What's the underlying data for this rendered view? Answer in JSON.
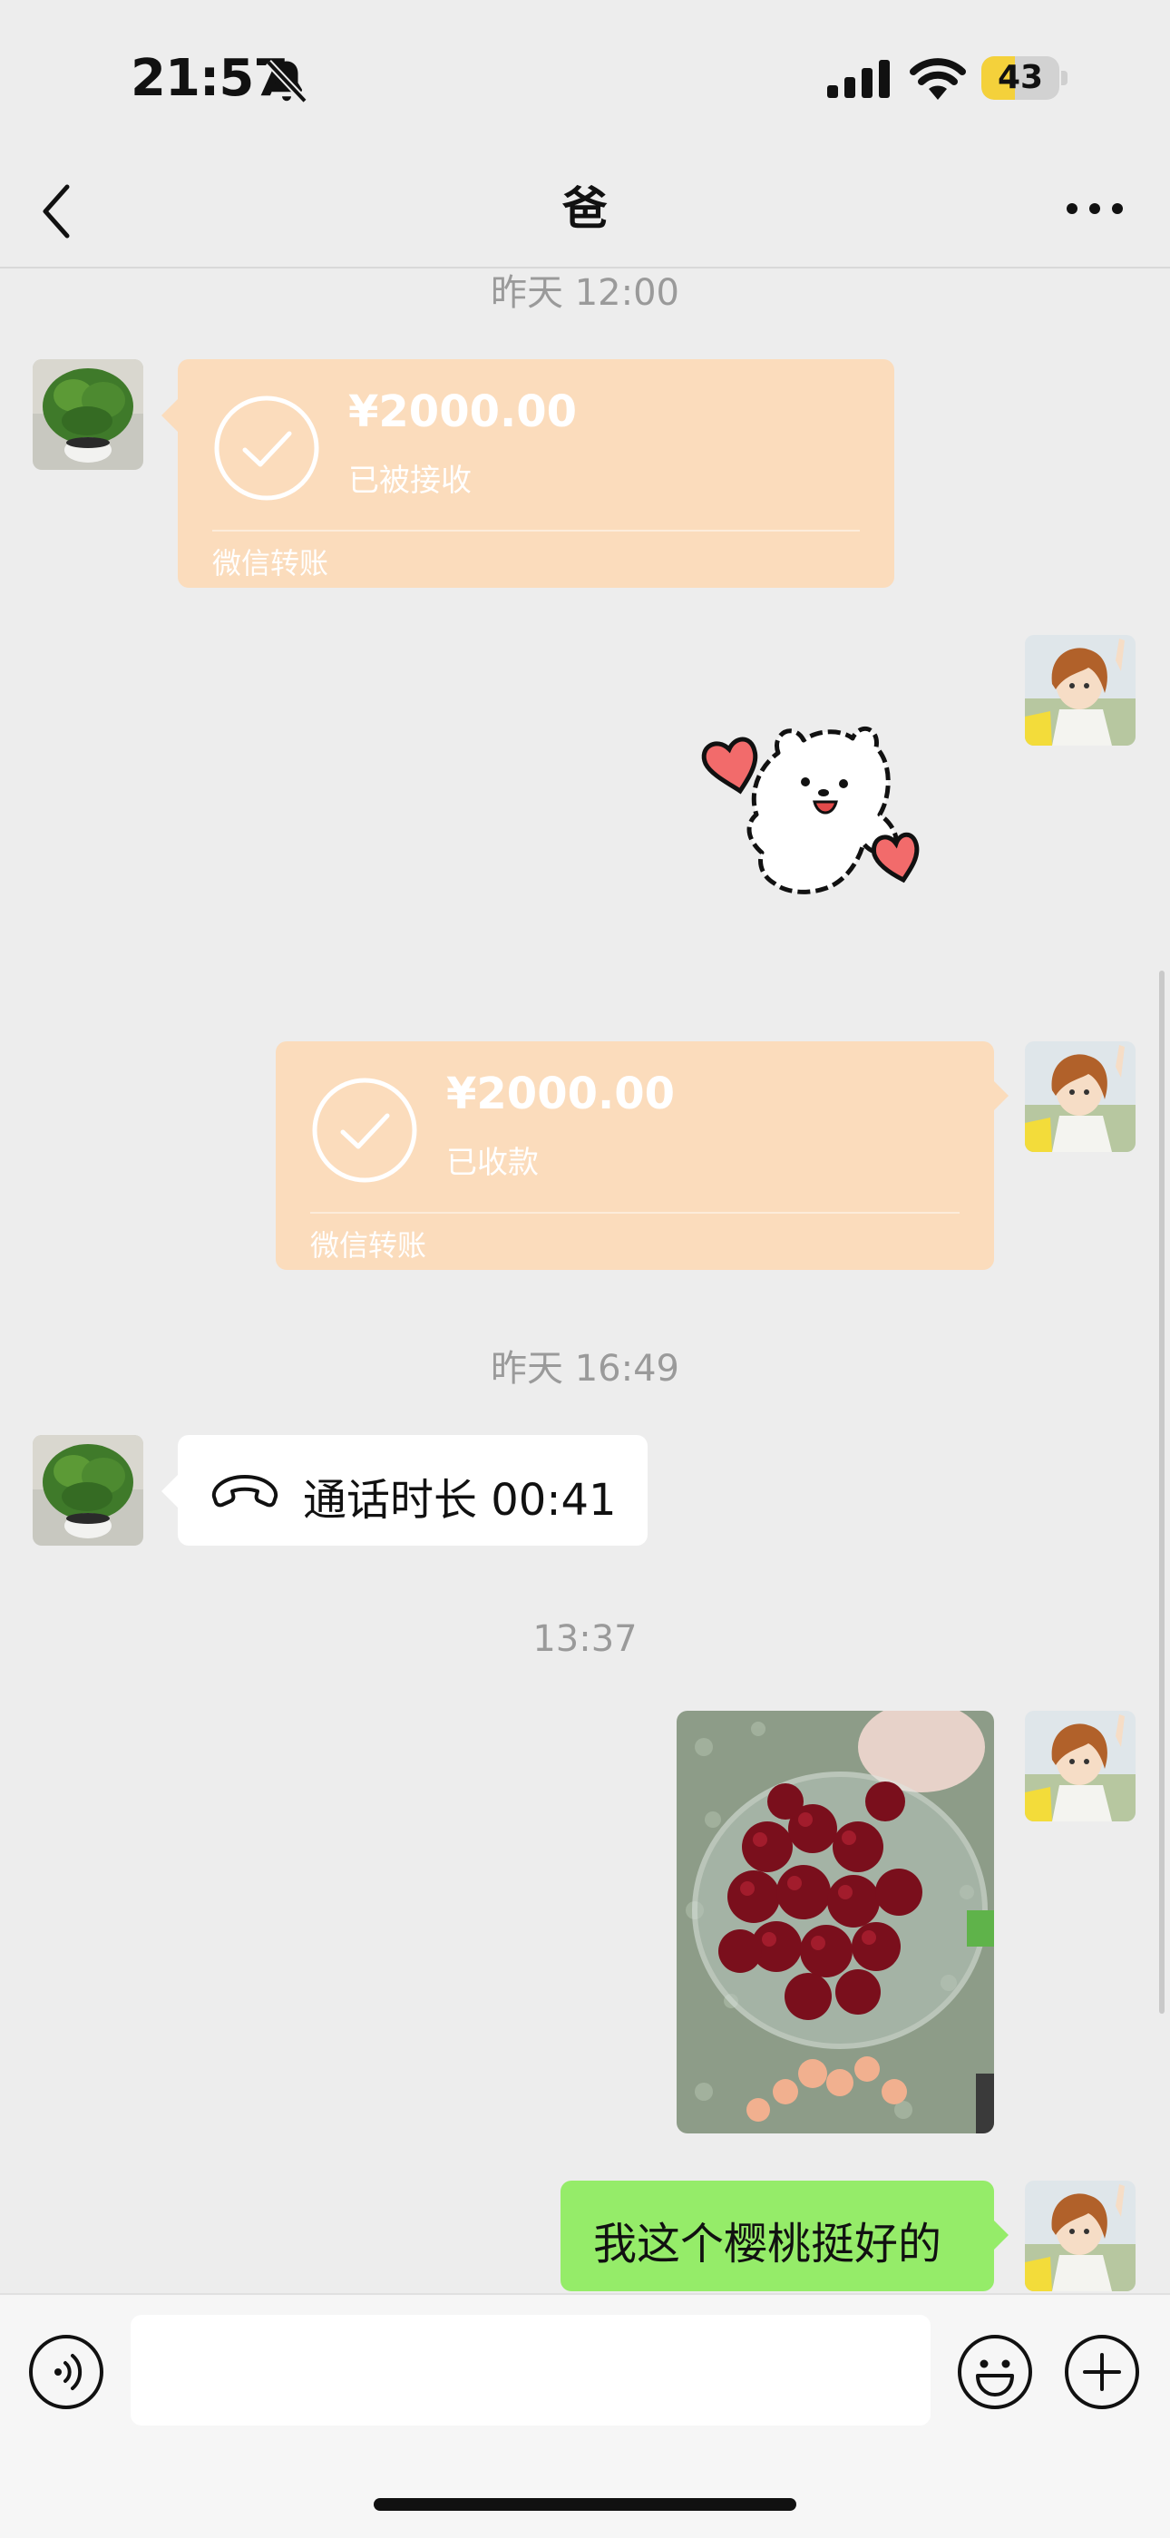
{
  "status_bar": {
    "time": "21:57",
    "battery_level": "43",
    "battery_fraction": 0.43,
    "battery_color": "#f4d13b",
    "icons": [
      "bell-slash-icon",
      "cellular-signal-icon",
      "wifi-icon",
      "battery-icon"
    ]
  },
  "nav": {
    "title": "爸",
    "back_icon": "chevron-left-icon",
    "more_icon": "ellipsis-icon"
  },
  "messages": {
    "timestamp_1": "昨天 12:00",
    "transfer_1": {
      "amount": "¥2000.00",
      "status": "已被接收",
      "source": "微信转账",
      "sender": "contact"
    },
    "sticker": {
      "icon": "bear-with-hearts-sticker",
      "sender": "me"
    },
    "transfer_2": {
      "amount": "¥2000.00",
      "status": "已收款",
      "source": "微信转账",
      "sender": "me"
    },
    "timestamp_2": "昨天 16:49",
    "call": {
      "text": "通话时长 00:41",
      "icon": "phone-hangup-icon",
      "sender": "contact"
    },
    "timestamp_3": "13:37",
    "photo": {
      "subject": "cherries-in-glass-bowl-photo",
      "sender": "me"
    },
    "text_1": {
      "text": "我这个樱桃挺好的",
      "sender": "me"
    }
  },
  "input_bar": {
    "voice_icon": "voice-icon",
    "emoji_icon": "emoji-icon",
    "plus_icon": "plus-circle-icon",
    "input_value": ""
  },
  "colors": {
    "background": "#ededed",
    "transfer_bubble": "#fbdcbc",
    "my_text_bubble": "#95ec69",
    "contact_bubble": "#ffffff"
  }
}
